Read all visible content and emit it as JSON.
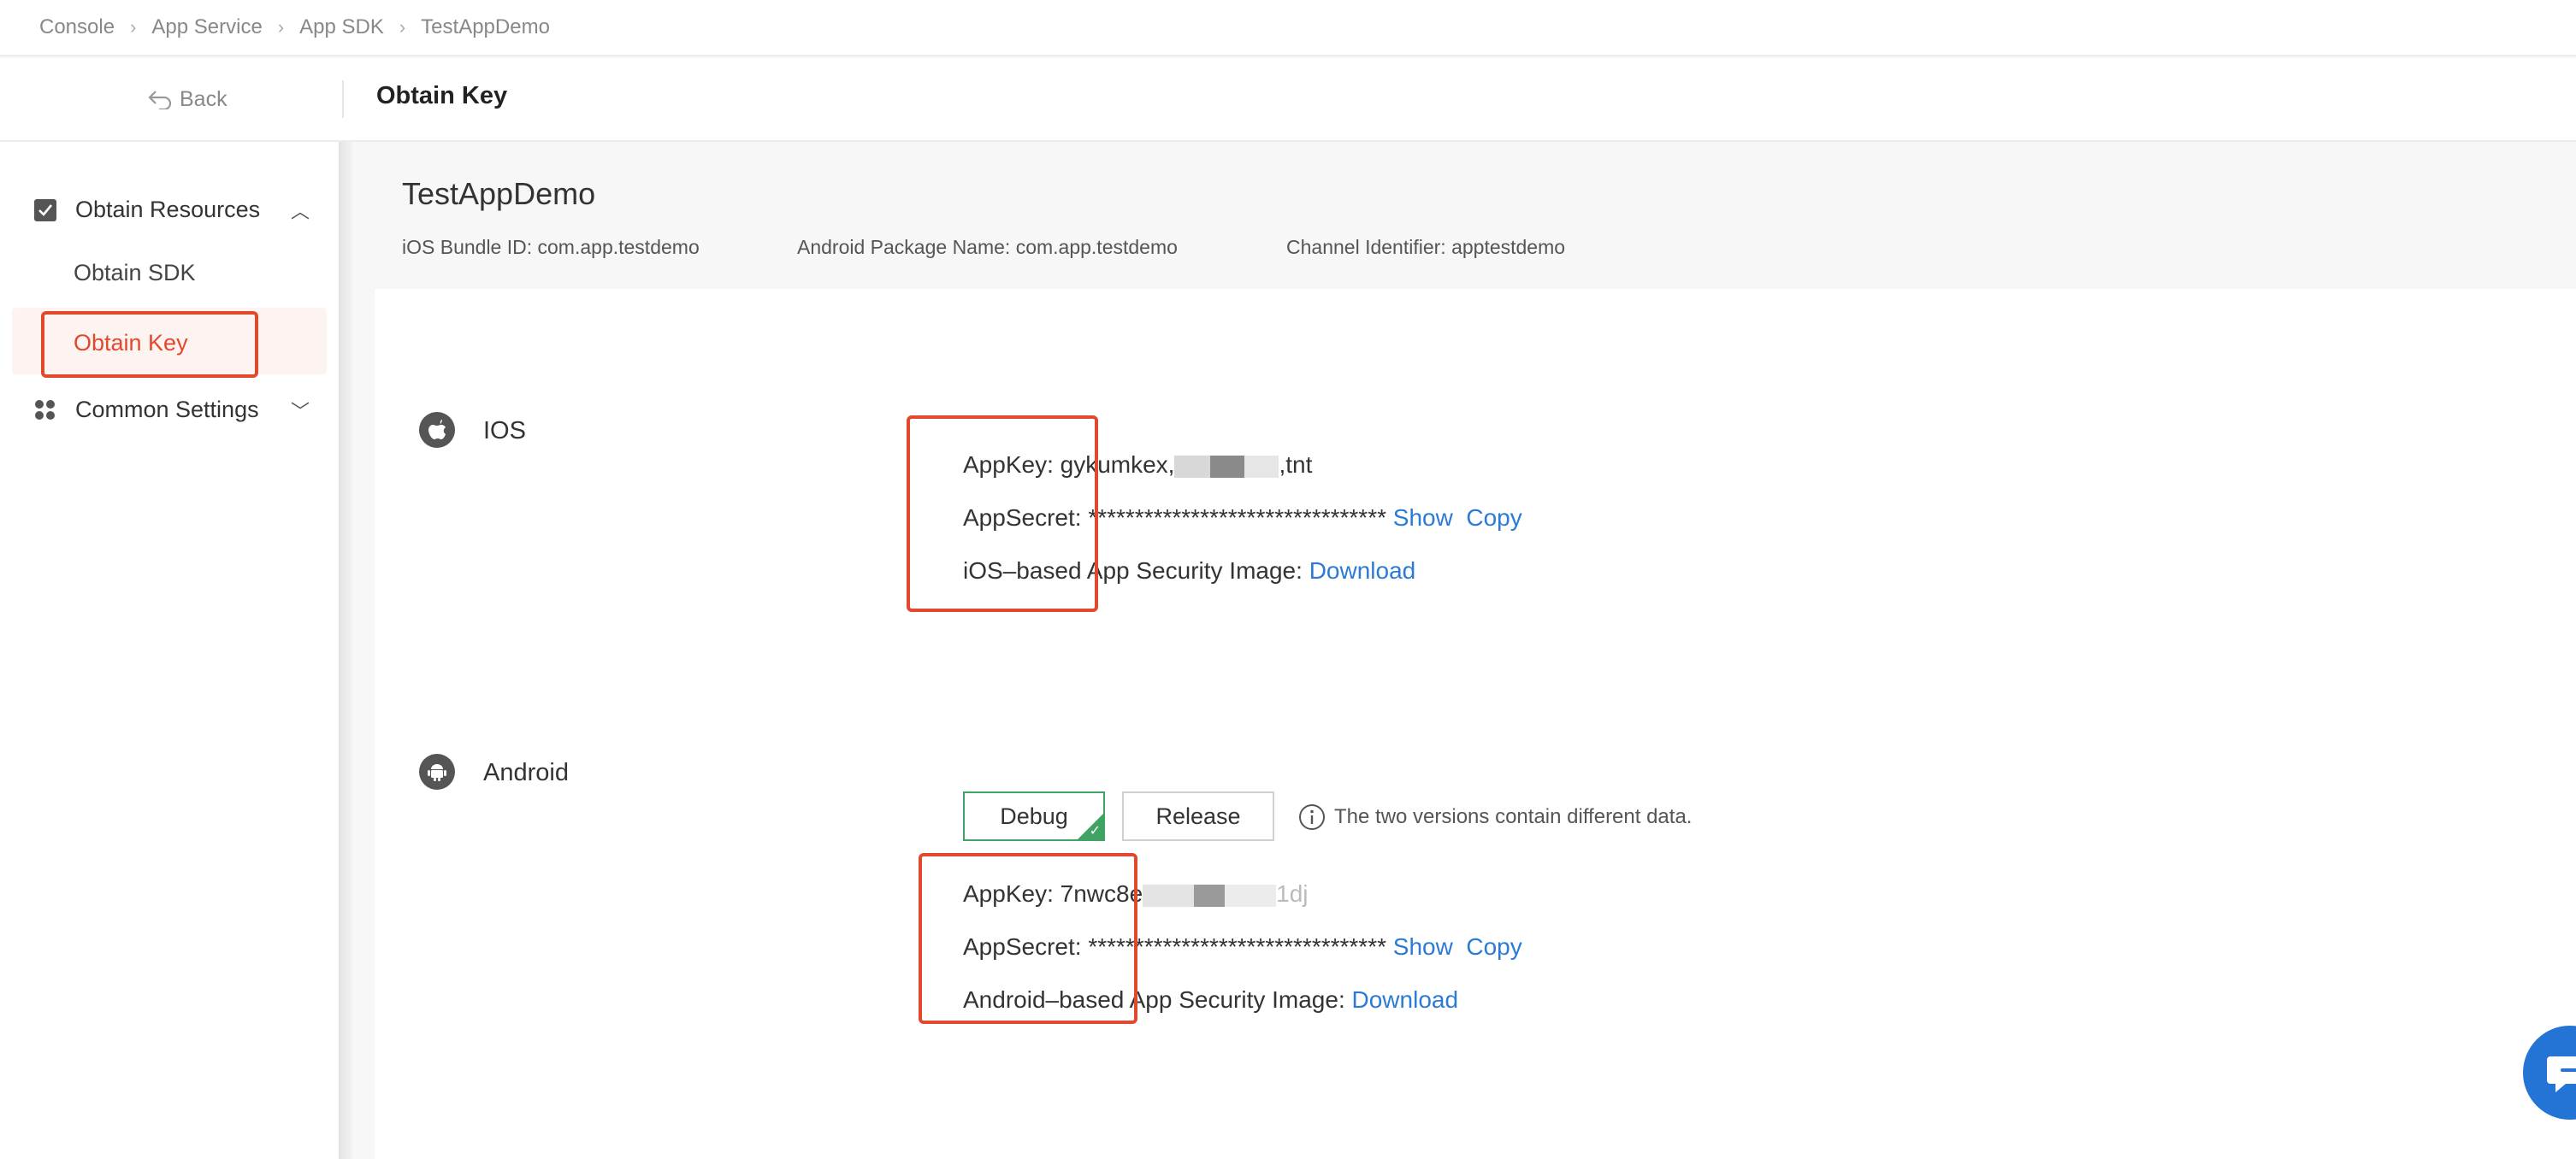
{
  "breadcrumb": {
    "items": [
      "Console",
      "App Service",
      "App SDK",
      "TestAppDemo"
    ]
  },
  "header": {
    "back_label": "Back",
    "title": "Obtain Key"
  },
  "sidebar": {
    "groups": [
      {
        "label": "Obtain Resources",
        "expanded": true,
        "items": [
          "Obtain SDK",
          "Obtain Key"
        ]
      },
      {
        "label": "Common Settings",
        "expanded": false
      }
    ],
    "active_item": "Obtain Key"
  },
  "app": {
    "name": "TestAppDemo",
    "ios_bundle": "iOS Bundle ID: com.app.testdemo",
    "android_package": "Android Package Name: com.app.testdemo",
    "channel": "Channel Identifier: apptestdemo"
  },
  "ios": {
    "platform": "IOS",
    "appkey_label": "AppKey:",
    "appkey_prefix": "gykumkex,",
    "appkey_suffix": ",tnt",
    "appsecret_label": "AppSecret:",
    "appsecret_value": "********************************",
    "show": "Show",
    "copy": "Copy",
    "image_label": "iOS–based App Security Image:",
    "download": "Download"
  },
  "android": {
    "platform": "Android",
    "tabs": [
      "Debug",
      "Release"
    ],
    "active_tab": "Debug",
    "info_text": "The two versions contain different data.",
    "appkey_label": "AppKey:",
    "appkey_prefix": "7nwc8e",
    "appkey_suffix": "1dj",
    "appsecret_label": "AppSecret:",
    "appsecret_value": "********************************",
    "show": "Show",
    "copy": "Copy",
    "image_label": "Android–based App Security Image:",
    "download": "Download"
  },
  "colors": {
    "accent": "#e2482c",
    "link": "#2b7bd6",
    "active_green": "#3fa463",
    "active_item_bg": "#fdf3f1",
    "chat_fab": "#2474d6"
  }
}
